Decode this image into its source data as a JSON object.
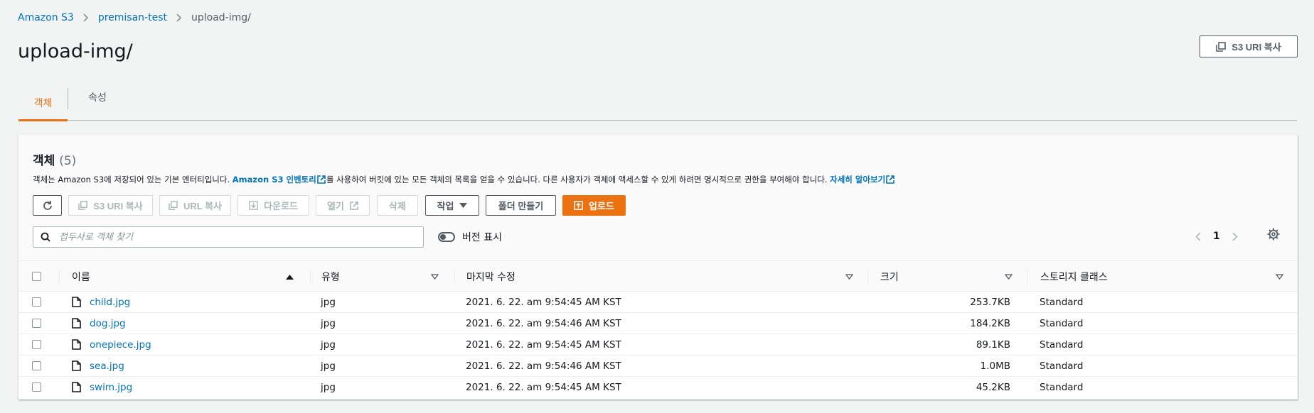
{
  "breadcrumb": {
    "items": [
      "Amazon S3",
      "premisan-test"
    ],
    "current": "upload-img/"
  },
  "page": {
    "title": "upload-img/",
    "copy_uri_label": "S3 URI 복사"
  },
  "tabs": [
    "객체",
    "속성"
  ],
  "panel": {
    "title": "객체",
    "count": "(5)",
    "desc_part1": "객체는 Amazon S3에 저장되어 있는 기본 엔터티입니다. ",
    "desc_link1": "Amazon S3 인벤토리",
    "desc_part2": "를 사용하여 버킷에 있는 모든 객체의 목록을 얻을 수 있습니다. 다른 사용자가 객체에 액세스할 수 있게 하려면 명시적으로 권한을 부여해야 합니다. ",
    "desc_link2": "자세히 알아보기"
  },
  "toolbar": {
    "copy_s3_uri": "S3 URI 복사",
    "copy_url": "URL 복사",
    "download": "다운로드",
    "open": "열기",
    "delete": "삭제",
    "actions": "작업",
    "create_folder": "폴더 만들기",
    "upload": "업로드"
  },
  "search": {
    "placeholder": "접두사로 객체 찾기"
  },
  "show_versions_label": "버전 표시",
  "pagination": {
    "page": "1"
  },
  "table": {
    "columns": [
      "이름",
      "유형",
      "마지막 수정",
      "크기",
      "스토리지 클래스"
    ],
    "rows": [
      {
        "name": "child.jpg",
        "type": "jpg",
        "modified": "2021. 6. 22. am 9:54:45 AM KST",
        "size": "253.7KB",
        "storage": "Standard"
      },
      {
        "name": "dog.jpg",
        "type": "jpg",
        "modified": "2021. 6. 22. am 9:54:46 AM KST",
        "size": "184.2KB",
        "storage": "Standard"
      },
      {
        "name": "onepiece.jpg",
        "type": "jpg",
        "modified": "2021. 6. 22. am 9:54:45 AM KST",
        "size": "89.1KB",
        "storage": "Standard"
      },
      {
        "name": "sea.jpg",
        "type": "jpg",
        "modified": "2021. 6. 22. am 9:54:46 AM KST",
        "size": "1.0MB",
        "storage": "Standard"
      },
      {
        "name": "swim.jpg",
        "type": "jpg",
        "modified": "2021. 6. 22. am 9:54:45 AM KST",
        "size": "45.2KB",
        "storage": "Standard"
      }
    ]
  },
  "colors": {
    "accent": "#ec7211",
    "link": "#0073bb",
    "text": "#16191f"
  }
}
